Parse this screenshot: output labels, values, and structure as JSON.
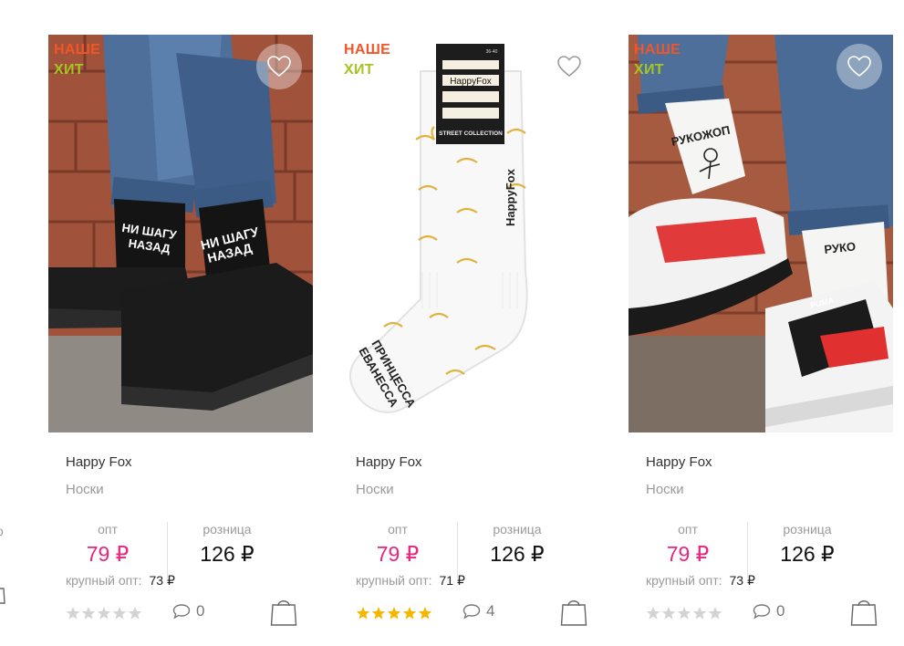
{
  "left_edge": {
    "label_fragment": "о"
  },
  "products": [
    {
      "badge": {
        "line1": "НАШЕ",
        "line2": "ХИТ"
      },
      "photo": {
        "sock_color": "#141414",
        "sock_text_l1": "НИ ШАГУ",
        "sock_text_l2": "НАЗАД"
      },
      "brand": "Happy Fox",
      "category": "Носки",
      "opt_label": "опт",
      "opt_price": "79 ₽",
      "retail_label": "розница",
      "retail_price": "126 ₽",
      "bulk_label": "крупный опт:",
      "bulk_price": "73 ₽",
      "rating": 0,
      "comments": "0"
    },
    {
      "badge": {
        "line1": "НАШЕ",
        "line2": "ХИТ"
      },
      "photo": {
        "tag_brand": "HappyFox",
        "tag_caption": "STREET COLLECTION",
        "tag_size": "36-40",
        "sock_brand": "HappyFox",
        "sock_text_l1": "ПРИНЦЕССА",
        "sock_text_l2": "ЕВАНЕССА"
      },
      "brand": "Happy Fox",
      "category": "Носки",
      "opt_label": "опт",
      "opt_price": "79 ₽",
      "retail_label": "розница",
      "retail_price": "126 ₽",
      "bulk_label": "крупный опт:",
      "bulk_price": "71 ₽",
      "rating": 5,
      "comments": "4"
    },
    {
      "badge": {
        "line1": "НАШЕ",
        "line2": "ХИТ"
      },
      "photo": {
        "sock_text_l1": "РУКОЖОП",
        "sock_text_l2": "РУКО",
        "shoe_logo": "PUMA"
      },
      "brand": "Happy Fox",
      "category": "Носки",
      "opt_label": "опт",
      "opt_price": "79 ₽",
      "retail_label": "розница",
      "retail_price": "126 ₽",
      "bulk_label": "крупный опт:",
      "bulk_price": "73 ₽",
      "rating": 0,
      "comments": "0"
    }
  ],
  "colors": {
    "accent": "#e6267f",
    "badge_orange": "#f0562a",
    "badge_green": "#a6c422",
    "star_on": "#f5b800",
    "star_off": "#d3d3d3"
  }
}
